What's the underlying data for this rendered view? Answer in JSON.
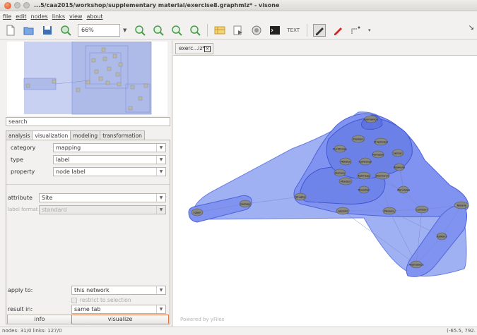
{
  "window": {
    "title": "...5/caa2015/workshop/supplementary material/exercise8.graphmlz* - visone"
  },
  "menu": [
    "file",
    "edit",
    "nodes",
    "links",
    "view",
    "about"
  ],
  "toolbar": {
    "zoom": "66%",
    "text_label": "TEXT",
    "icons": [
      "new-file-icon",
      "open-folder-icon",
      "save-icon",
      "zoom-icon",
      "zoom-in-icon",
      "zoom-out-icon",
      "zoom-fit-icon",
      "zoom-reset-icon",
      "table-icon",
      "export-icon",
      "search-network-icon",
      "console-icon",
      "text-icon",
      "pen-icon",
      "red-pen-icon",
      "select-icon"
    ]
  },
  "left": {
    "search_value": "search",
    "tabs": [
      "analysis",
      "visualization",
      "modeling",
      "transformation"
    ],
    "active_tab": "visualization",
    "category_label": "category",
    "category_value": "mapping",
    "type_label": "type",
    "type_value": "label",
    "property_label": "property",
    "property_value": "node label",
    "attribute_label": "attribute",
    "attribute_value": "Site",
    "label_format_label": "label format",
    "label_format_value": "standard",
    "apply_to_label": "apply to:",
    "apply_to_value": "this network",
    "restrict_label": "restrict to selection",
    "result_in_label": "result in:",
    "result_in_value": "same tab",
    "info_button": "info",
    "visualize_button": "visualize"
  },
  "canvas": {
    "doc_tab": "exerc...iz*",
    "powered_by": "Powered by yFiles",
    "node_labels": [
      "Lukmanion",
      "Proskeni",
      "Chlemideni",
      "Ruchtlusse",
      "Sensan",
      "Malistol",
      "Galiwanan",
      "Pamapali",
      "Pelakano",
      "Xiahusu",
      "Miadesi",
      "Kalimepo",
      "Akamarun",
      "Wanolelea",
      "Troxallion",
      "Sinapte",
      "Latoniki",
      "Mesaino",
      "Lomisari",
      "Telsaria",
      "Kalkaro",
      "Akomaheus",
      "Isnapos",
      "Kinorrans",
      "Dukarde",
      "Teashe",
      "Logan",
      "Gariagu"
    ]
  },
  "status": {
    "left": "nodes: 31/0 links: 127/0",
    "right": "(-65.5, 792."
  },
  "colors": {
    "hull_fill": "#7d93f2",
    "hull_dark": "#5a74e0",
    "node_fill": "#8a8a82",
    "accent": "#e0764a"
  }
}
